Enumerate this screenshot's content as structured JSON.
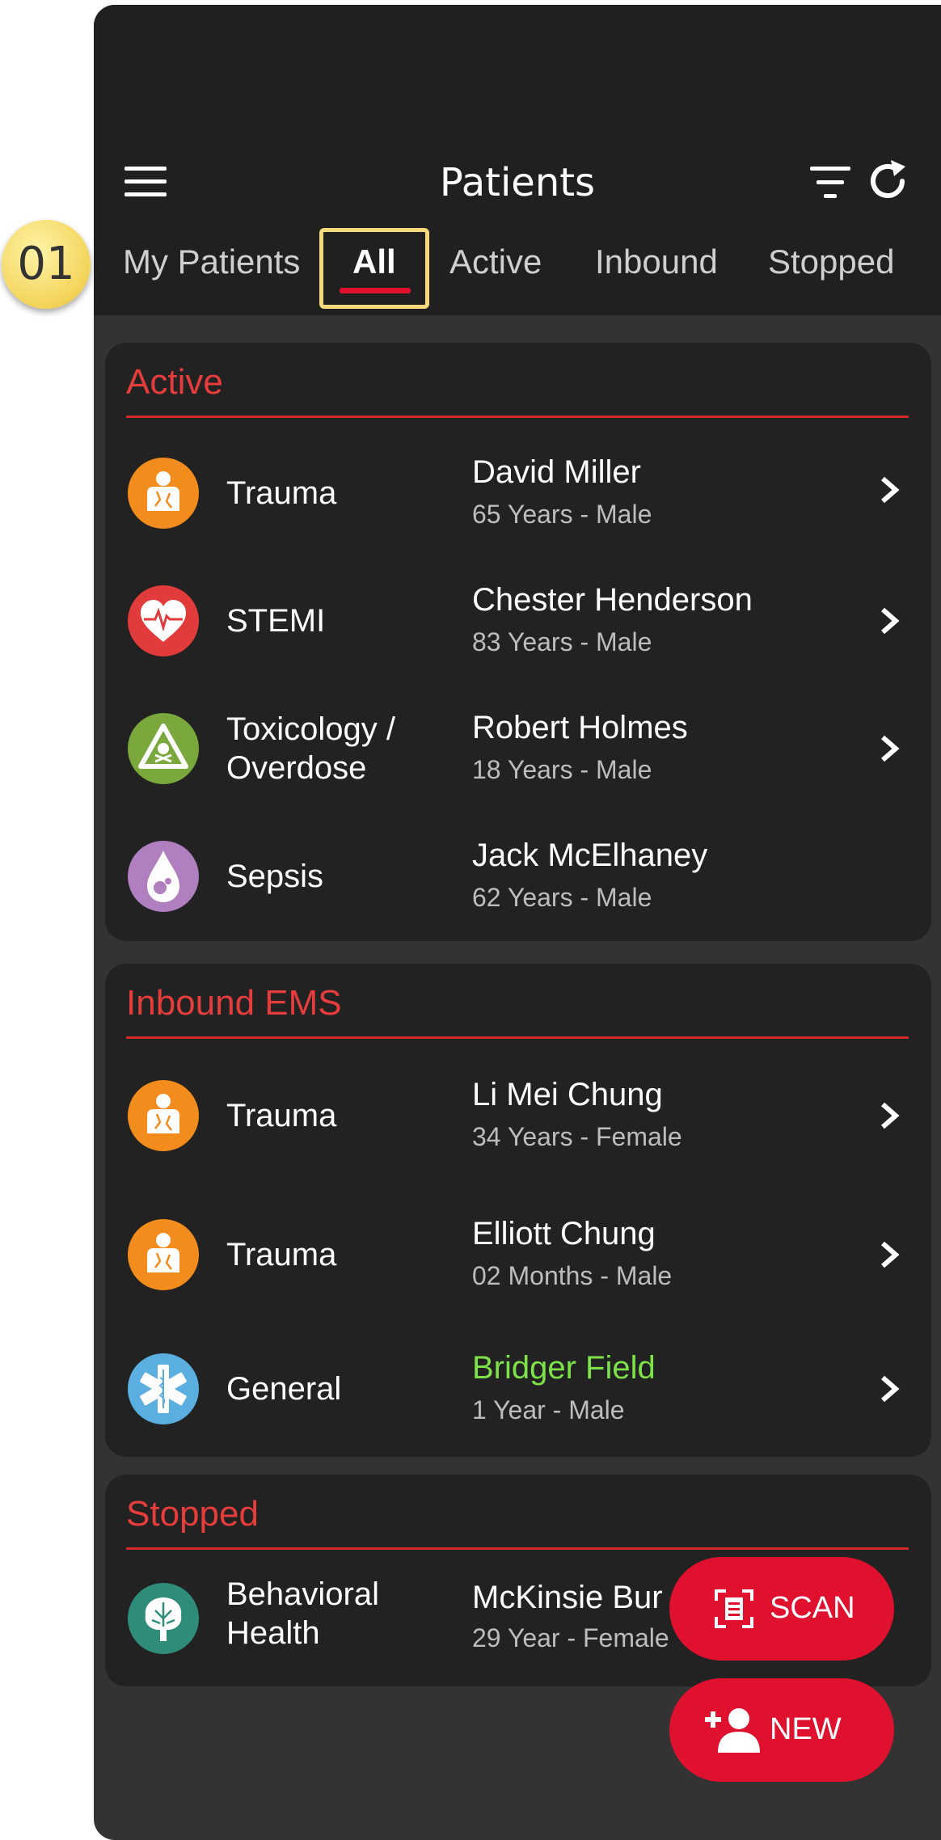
{
  "header": {
    "title": "Patients"
  },
  "tutorial_badge": "01",
  "tabs": [
    {
      "label": "My Patients"
    },
    {
      "label": "All"
    },
    {
      "label": "Active"
    },
    {
      "label": "Inbound"
    },
    {
      "label": "Stopped"
    }
  ],
  "selected_tab": "All",
  "sections": [
    {
      "title": "Active",
      "rows": [
        {
          "icon": "trauma-icon",
          "category": "Trauma",
          "name": "David Miller",
          "meta": "65 Years - Male"
        },
        {
          "icon": "heart-ecg-icon",
          "category": "STEMI",
          "name": "Chester Henderson",
          "meta": "83 Years - Male"
        },
        {
          "icon": "toxic-warning-icon",
          "category": "Toxicology /",
          "category2": "Overdose",
          "name": "Robert Holmes",
          "meta": "18 Years - Male"
        },
        {
          "icon": "blood-drop-icon",
          "category": "Sepsis",
          "name": "Jack McElhaney",
          "meta": "62 Years - Male"
        }
      ]
    },
    {
      "title": "Inbound EMS",
      "rows": [
        {
          "icon": "trauma-icon",
          "category": "Trauma",
          "name": "Li Mei Chung",
          "meta": "34 Years - Female"
        },
        {
          "icon": "trauma-icon",
          "category": "Trauma",
          "name": "Elliott Chung",
          "meta": "02 Months - Male"
        },
        {
          "icon": "star-of-life-icon",
          "category": "General",
          "name": "Bridger Field",
          "meta": "1 Year - Male"
        }
      ]
    },
    {
      "title": "Stopped",
      "rows": [
        {
          "icon": "brain-tree-icon",
          "category": "Behavioral",
          "category2": "Health",
          "name": "McKinsie Bur",
          "meta": "29 Year - Female"
        }
      ]
    }
  ],
  "buttons": {
    "scan": "SCAN",
    "new": "NEW"
  },
  "colors": {
    "accent_red": "#e0102f",
    "section_title_red": "#e53c3c",
    "highlight_name_green": "#7de14a",
    "trauma_orange": "#f28c1c",
    "stemi_red": "#e23b3b",
    "tox_green": "#7aa83c",
    "sepsis_purple": "#b07fc0",
    "general_blue": "#5aaee0",
    "behavioral_teal": "#2f8c78"
  }
}
